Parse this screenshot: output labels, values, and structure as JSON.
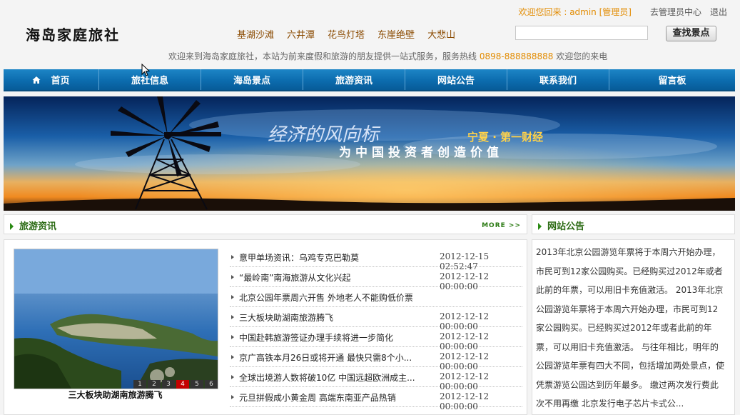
{
  "topbar": {
    "welcome": "欢迎您回来 : admin [管理员]",
    "admin_link": "去管理员中心",
    "logout_link": "退出"
  },
  "header": {
    "logo": "海岛家庭旅社",
    "quick_links": [
      "基湖沙滩",
      "六井潭",
      "花鸟灯塔",
      "东崖绝壁",
      "大悲山"
    ],
    "search_placeholder": "",
    "search_button": "查找景点",
    "slogan_prefix": "欢迎来到海岛家庭旅社，本站为前来度假和旅游的朋友提供一站式服务，服务热线",
    "hotline": "0898-888888888",
    "slogan_suffix": "欢迎您的来电"
  },
  "nav": {
    "items": [
      "首页",
      "旅社信息",
      "海岛景点",
      "旅游资讯",
      "网站公告",
      "联系我们",
      "留言板"
    ]
  },
  "banner": {
    "headline": "经济的风向标",
    "highlight": "宁夏 · 第一财经",
    "subline": "为中国投资者创造价值"
  },
  "news": {
    "title": "旅游资讯",
    "more": "MORE >>",
    "slide_caption": "三大板块助湖南旅游腾飞",
    "slide_numbers": [
      "1",
      "2",
      "3",
      "4",
      "5",
      "6"
    ],
    "slide_active": "4",
    "items": [
      {
        "title": "意甲单场资讯：乌鸡专克巴勒莫",
        "date": "2012-12-15 02:52:47"
      },
      {
        "title": "“最岭南”南海旅游从文化兴起",
        "date": "2012-12-12 00:00:00"
      },
      {
        "title": "北京公园年票周六开售 外地老人不能购低价票",
        "date": ""
      },
      {
        "title": "三大板块助湖南旅游腾飞",
        "date": "2012-12-12 00:00:00"
      },
      {
        "title": "中国赴韩旅游签证办理手续将进一步简化",
        "date": "2012-12-12 00:00:00"
      },
      {
        "title": "京广高铁本月26日或将开通 最快只需8个小...",
        "date": "2012-12-12 00:00:00"
      },
      {
        "title": "全球出境游人数将破10亿 中国远超欧洲成主...",
        "date": "2012-12-12 00:00:00"
      },
      {
        "title": "元旦拼假成小黄金周 高端东南亚产品热销",
        "date": "2012-12-12 00:00:00"
      }
    ]
  },
  "notice": {
    "title": "网站公告",
    "text": "2013年北京公园游览年票将于本周六开始办理，市民可到12家公园购买。已经购买过2012年或者此前的年票，可以用旧卡充值激活。 2013年北京公园游览年票将于本周六开始办理，市民可到12家公园购买。已经购买过2012年或者此前的年票，可以用旧卡充值激活。 与往年相比，明年的公园游览年票有四大不同，包括增加两处景点，使凭票游览公园达到历年最多。 缴过两次发行费此次不用再缴 北京发行电子芯片卡式公..."
  },
  "colors": {
    "nav_blue": "#0c6cae",
    "accent_orange": "#e28b00",
    "section_green": "#2a6a12",
    "active_red": "#c40000"
  }
}
